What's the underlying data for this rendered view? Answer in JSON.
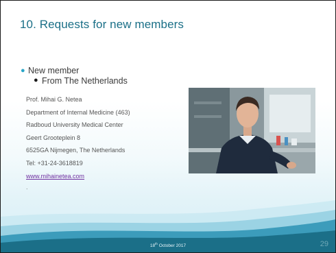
{
  "slide": {
    "title": "10. Requests for new members",
    "bullet_level1": "New member",
    "bullet_level2": "From The Netherlands",
    "address_lines": [
      "Prof. Mihai G. Netea",
      "Department of Internal Medicine (463)",
      "Radboud University Medical Center",
      "Geert Grooteplein 8",
      "6525GA Nijmegen, The Netherlands",
      "Tel: +31-24-3618819"
    ],
    "website": "www.mihainetea.com",
    "trailing_mark": ".",
    "footer_date_day": "18",
    "footer_date_suffix": "th",
    "footer_date_rest": " October 2017",
    "page_number": "29"
  },
  "colors": {
    "title": "#1a6f87",
    "bullet_accent": "#2aa6c8",
    "wave_dark": "#1b6f88",
    "link": "#7030a0"
  }
}
